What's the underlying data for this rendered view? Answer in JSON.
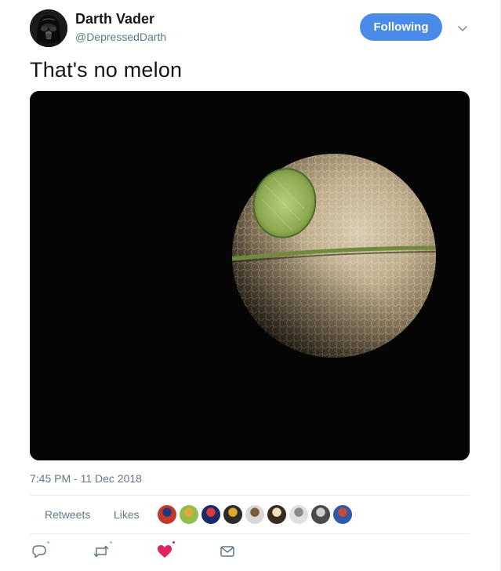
{
  "author": {
    "display_name": "Darth Vader",
    "screen_name": "@DepressedDarth"
  },
  "follow_button": {
    "label": "Following",
    "color": "#4a8ae8"
  },
  "menu_icon": "chevron-down-icon",
  "tweet": {
    "text": "That's no melon",
    "timestamp": "7:45 PM - 11 Dec 2018"
  },
  "media": {
    "description_icon": "melon-death-star-image"
  },
  "stats": {
    "retweets_label": "Retweets",
    "likes_label": "Likes"
  },
  "likers": [
    {
      "color": "#c0392b",
      "accent": "#1f3a7a"
    },
    {
      "color": "#8fbf4a",
      "accent": "#e2a640"
    },
    {
      "color": "#1a2a6b",
      "accent": "#d93b3b"
    },
    {
      "color": "#2b2b2b",
      "accent": "#e0a826"
    },
    {
      "color": "#d9d9d9",
      "accent": "#7a5a3a"
    },
    {
      "color": "#3a2a20",
      "accent": "#f0e0c0"
    },
    {
      "color": "#e0e0e0",
      "accent": "#8a8a8a"
    },
    {
      "color": "#4a4a4a",
      "accent": "#cfcfcf"
    },
    {
      "color": "#2f5aa8",
      "accent": "#c44a3a"
    }
  ],
  "actions": [
    {
      "name": "reply-icon"
    },
    {
      "name": "retweet-icon"
    },
    {
      "name": "heart-icon",
      "color": "#e0245e"
    },
    {
      "name": "direct-message-icon"
    }
  ]
}
